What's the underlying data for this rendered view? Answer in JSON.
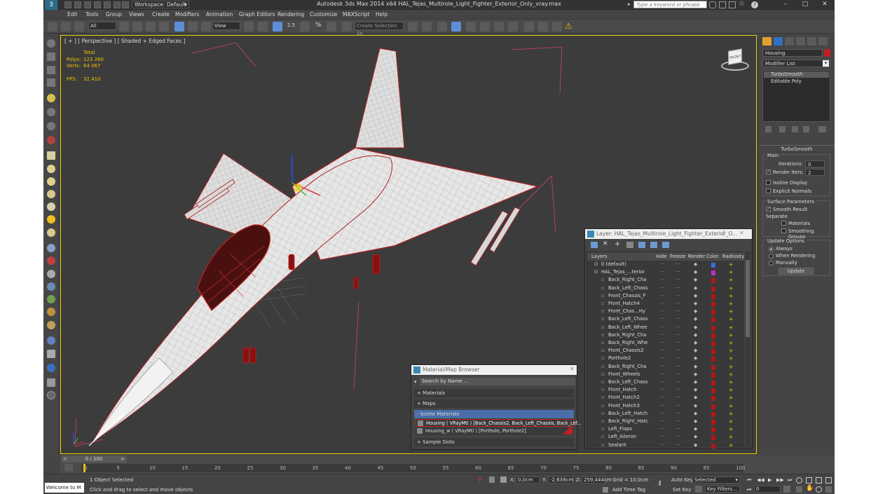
{
  "titlebar": {
    "workspace": "Workspace: Default",
    "title": "Autodesk 3ds Max  2014 x64      HAL_Tejas_Multirole_Light_Fighter_Exterior_Only_vray.max",
    "search_placeholder": "Type a keyword or phrase",
    "minimize": "–",
    "maximize": "□",
    "close": "✕"
  },
  "menu": [
    "Edit",
    "Tools",
    "Group",
    "Views",
    "Create",
    "Modifiers",
    "Animation",
    "Graph Editors",
    "Rendering",
    "Customize",
    "MAXScript",
    "Help"
  ],
  "toolbar": {
    "selection_filter": "All",
    "ref_coord": "View",
    "selection_set": "Create Selection Se",
    "snap_label": "2.5",
    "percent_label": "%"
  },
  "viewport": {
    "label": "[ + ] [ Perspective ] [ Shaded + Edged Faces ]",
    "stats_total": "Total",
    "polys_label": "Polys:",
    "polys_value": "123 260",
    "verts_label": "Verts:",
    "verts_value": "64 067",
    "fps_label": "FPS:",
    "fps_value": "32,410",
    "viewcube_label": "FRONT"
  },
  "command_panel": {
    "object_name": "Housing",
    "modifier_list": "Modifier List",
    "stack": [
      "TurboSmooth",
      "Editable Poly"
    ],
    "rollout_title": "TurboSmooth",
    "main_label": "Main",
    "iterations_label": "Iterations:",
    "iterations_value": "0",
    "render_iters_label": "Render Iters:",
    "render_iters_value": "2",
    "isoline": "Isoline Display",
    "explicit_normals": "Explicit Normals",
    "surface_params": "Surface Parameters",
    "smooth_result": "Smooth Result",
    "separate": "Separate",
    "materials": "Materials",
    "smoothing_groups": "Smoothing Groups",
    "update_options": "Update Options",
    "always": "Always",
    "when_rendering": "When Rendering",
    "manually": "Manually",
    "update_button": "Update"
  },
  "layer_dialog": {
    "title": "Layer: HAL_Tejas_Multirole_Light_Fighter_Exterior_O...",
    "help": "?",
    "close": "✕",
    "columns": [
      "Layers",
      "Hide",
      "Freeze",
      "Render",
      "Color",
      "Radiosity"
    ],
    "rows": [
      {
        "name": "0 (default)",
        "color": "#3b6bd8",
        "indent": 1
      },
      {
        "name": "HAL_Tejas_...terior",
        "color": "#c030c0",
        "indent": 1
      },
      {
        "name": "Back_Right_Cha",
        "color": "#b01818",
        "indent": 2
      },
      {
        "name": "Back_Left_Chass",
        "color": "#b01818",
        "indent": 2
      },
      {
        "name": "Front_Chassis_F",
        "color": "#b01818",
        "indent": 2
      },
      {
        "name": "Front_Hatch4",
        "color": "#b01818",
        "indent": 2
      },
      {
        "name": "Front_Chas...Hy",
        "color": "#b01818",
        "indent": 2
      },
      {
        "name": "Back_Left_Chass",
        "color": "#b01818",
        "indent": 2
      },
      {
        "name": "Back_Left_Whee",
        "color": "#b01818",
        "indent": 2
      },
      {
        "name": "Back_Right_Cha",
        "color": "#b01818",
        "indent": 2
      },
      {
        "name": "Back_Right_Whe",
        "color": "#b01818",
        "indent": 2
      },
      {
        "name": "Front_Chassis2",
        "color": "#b01818",
        "indent": 2
      },
      {
        "name": "Porthole2",
        "color": "#b01818",
        "indent": 2
      },
      {
        "name": "Back_Right_Cha",
        "color": "#b01818",
        "indent": 2
      },
      {
        "name": "Front_Wheels",
        "color": "#b01818",
        "indent": 2
      },
      {
        "name": "Back_Left_Chass",
        "color": "#b01818",
        "indent": 2
      },
      {
        "name": "Front_Hatch",
        "color": "#b01818",
        "indent": 2
      },
      {
        "name": "Front_Hatch2",
        "color": "#b01818",
        "indent": 2
      },
      {
        "name": "Front_Hatch3",
        "color": "#b01818",
        "indent": 2
      },
      {
        "name": "Back_Left_Hatch",
        "color": "#b01818",
        "indent": 2
      },
      {
        "name": "Back_Right_Hatc",
        "color": "#b01818",
        "indent": 2
      },
      {
        "name": "Left_Flaps",
        "color": "#b01818",
        "indent": 2
      },
      {
        "name": "Left_Aileron",
        "color": "#b01818",
        "indent": 2
      },
      {
        "name": "Sealant",
        "color": "#b01818",
        "indent": 2
      }
    ]
  },
  "material_browser": {
    "title": "Material/Map Browser",
    "close": "✕",
    "search": "Search by Name ...",
    "materials": "+ Materials",
    "maps": "+ Maps",
    "scene_materials": "- Scene Materials",
    "items": [
      "Housing ( VRayMtl ) [Back_Chassis2, Back_Left_Chassis, Back_Lef...",
      "Housing_w ( VRayMtl ) [Porthole, Porthole2]"
    ],
    "sample_slots": "+ Sample Slots"
  },
  "timeline": {
    "frame": "0 / 100",
    "ticks": [
      "0",
      "5",
      "10",
      "15",
      "20",
      "25",
      "30",
      "35",
      "40",
      "45",
      "50",
      "55",
      "60",
      "65",
      "70",
      "75",
      "80",
      "85",
      "90",
      "95",
      "100"
    ]
  },
  "status": {
    "welcome": "Welcome to M",
    "selection": "1 Object Selected",
    "prompt": "Click and drag to select and move objects",
    "x_label": "X:",
    "x_value": "0,0cm",
    "y_label": "Y:",
    "y_value": "-2,639cm",
    "z_label": "Z:",
    "z_value": "259,444cm",
    "grid": "Grid = 10,0cm",
    "add_time_tag": "Add Time Tag",
    "auto_key": "Auto Key",
    "set_key": "Set Key",
    "selected": "Selected",
    "key_filters": "Key Filters...",
    "frame_value": "0"
  }
}
